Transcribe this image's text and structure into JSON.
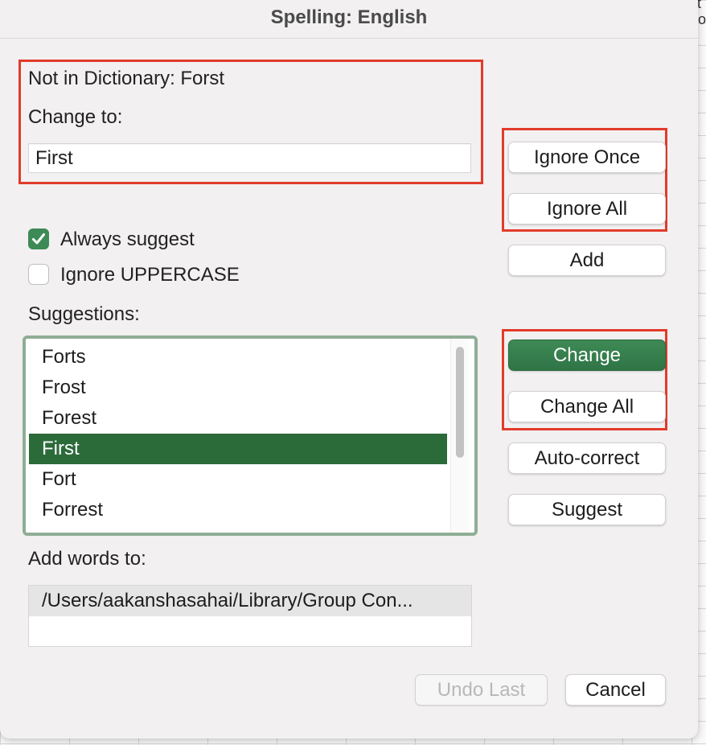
{
  "background": {
    "text_1": "ct",
    "text_2": "oo"
  },
  "dialog": {
    "title": "Spelling: English",
    "not_in_dictionary_label": "Not in Dictionary: Forst",
    "change_to_label": "Change to:",
    "change_to_value": "First",
    "always_suggest": {
      "label": "Always suggest",
      "checked": true
    },
    "ignore_uppercase": {
      "label": "Ignore UPPERCASE",
      "checked": false
    },
    "suggestions_label": "Suggestions:",
    "suggestions": [
      "Forts",
      "Frost",
      "Forest",
      "First",
      "Fort",
      "Forrest"
    ],
    "selected_suggestion": "First",
    "add_words_label": "Add words to:",
    "dictionary_path": "/Users/aakanshasahai/Library/Group Con...",
    "buttons": {
      "ignore_once": "Ignore Once",
      "ignore_all": "Ignore All",
      "add": "Add",
      "change": "Change",
      "change_all": "Change All",
      "auto_correct": "Auto-correct",
      "suggest": "Suggest",
      "undo_last": "Undo Last",
      "cancel": "Cancel"
    }
  },
  "colors": {
    "accent_green": "#2f7446",
    "selection_green": "#2b6a39",
    "highlight_red": "#e23b2a",
    "list_border": "#8fae95"
  }
}
